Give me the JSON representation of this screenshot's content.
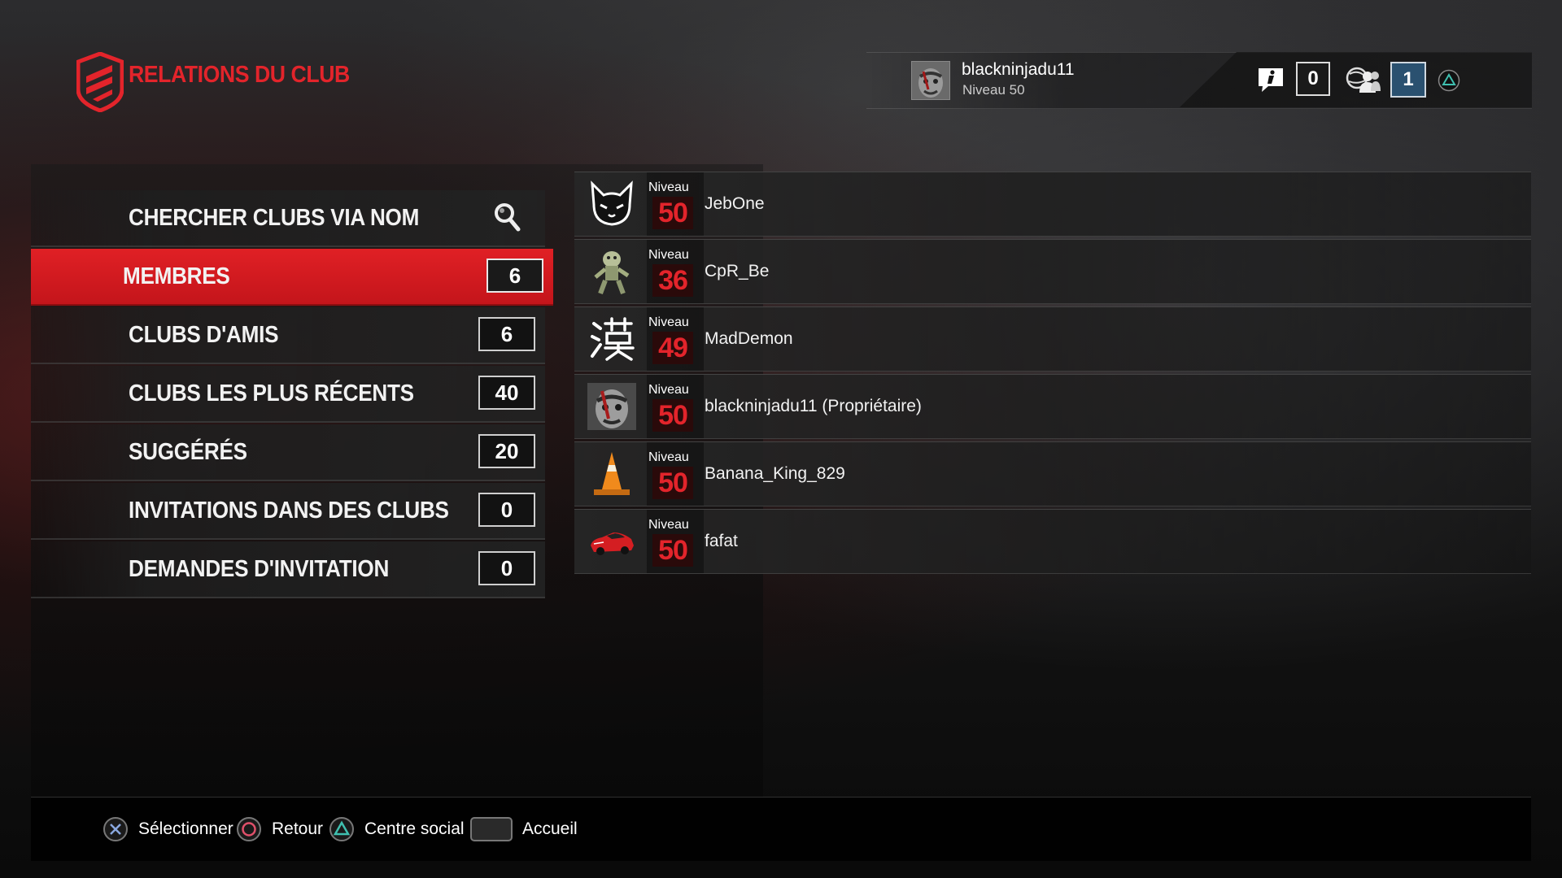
{
  "header": {
    "title": "RELATIONS DU CLUB",
    "username": "blackninjadu11",
    "user_level": "Niveau 50",
    "info_count": "0",
    "friends_count": "1"
  },
  "menu": {
    "search_label": "CHERCHER CLUBS VIA NOM",
    "items": [
      {
        "label": "MEMBRES",
        "count": "6"
      },
      {
        "label": "CLUBS D'AMIS",
        "count": "6"
      },
      {
        "label": "CLUBS LES PLUS RÉCENTS",
        "count": "40"
      },
      {
        "label": "SUGGÉRÉS",
        "count": "20"
      },
      {
        "label": "INVITATIONS DANS DES CLUBS",
        "count": "0"
      },
      {
        "label": "DEMANDES D'INVITATION",
        "count": "0"
      }
    ]
  },
  "members": [
    {
      "level_label": "Niveau",
      "level": "50",
      "name": "JebOne",
      "avatar": "cat-face-icon"
    },
    {
      "level_label": "Niveau",
      "level": "36",
      "name": "CpR_Be",
      "avatar": "creature-icon"
    },
    {
      "level_label": "Niveau",
      "level": "49",
      "name": "MadDemon",
      "avatar": "kanji-icon"
    },
    {
      "level_label": "Niveau",
      "level": "50",
      "name": "blackninjadu11 (Propriétaire)",
      "avatar": "warrior-face-icon"
    },
    {
      "level_label": "Niveau",
      "level": "50",
      "name": "Banana_King_829",
      "avatar": "traffic-cone-icon"
    },
    {
      "level_label": "Niveau",
      "level": "50",
      "name": "fafat",
      "avatar": "red-car-icon"
    }
  ],
  "footer": {
    "select": "Sélectionner",
    "back": "Retour",
    "social": "Centre social",
    "home": "Accueil"
  },
  "colors": {
    "accent_red": "#e3242b",
    "friends_blue": "#2a5170"
  }
}
